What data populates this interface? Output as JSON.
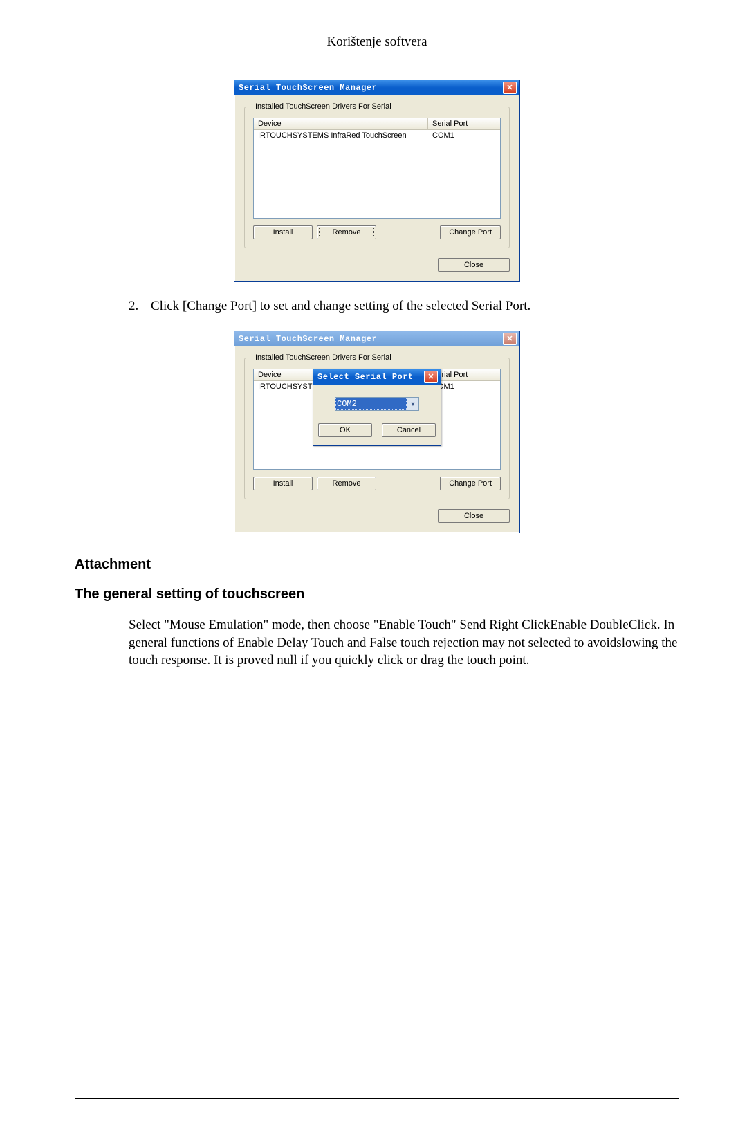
{
  "header": {
    "title": "Korištenje softvera"
  },
  "dialog": {
    "title": "Serial TouchScreen Manager",
    "group_label": "Installed TouchScreen Drivers For Serial",
    "columns": {
      "device": "Device",
      "port": "Serial Port"
    },
    "rows": [
      {
        "device": "IRTOUCHSYSTEMS InfraRed TouchScreen",
        "port": "COM1"
      }
    ],
    "truncated_device": "IRTOUCHSYSTE",
    "buttons": {
      "install": "Install",
      "remove": "Remove",
      "change_port": "Change Port",
      "close": "Close"
    }
  },
  "select_port_dialog": {
    "title": "Select Serial Port",
    "value": "COM2",
    "ok": "OK",
    "cancel": "Cancel"
  },
  "step": {
    "number": "2.",
    "text": "Click [Change Port] to set and change setting of the selected Serial Port."
  },
  "headings": {
    "attachment": "Attachment",
    "general": "The general setting of touchscreen"
  },
  "paragraph": "Select \"Mouse Emulation\" mode, then choose \"Enable Touch\" Send Right ClickEnable DoubleClick. In general functions of Enable Delay Touch and False touch rejection may not selected to avoidslowing the touch response. It is proved null if you quickly click or drag the touch point."
}
